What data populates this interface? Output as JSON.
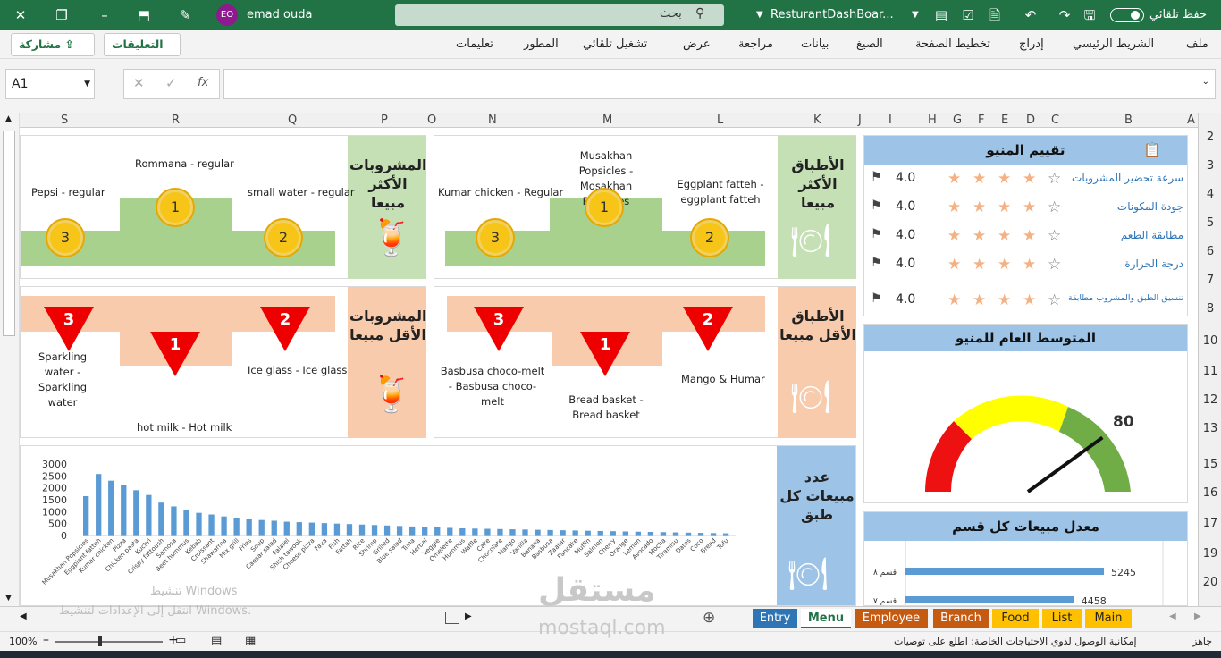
{
  "titlebar": {
    "autosave_label": "حفظ تلقائي",
    "filename": "ResturantDashBoar...",
    "search_placeholder": "بحث",
    "user_name": "emad ouda",
    "user_initials": "EO"
  },
  "ribbon": {
    "menu": [
      "ملف",
      "الشريط الرئيسي",
      "إدراج",
      "تخطيط الصفحة",
      "الصيغ",
      "بيانات",
      "مراجعة",
      "عرض",
      "تشغيل تلقائي",
      "المطور",
      "تعليمات"
    ],
    "comments_label": "التعليقات",
    "share_label": "مشاركة"
  },
  "formula_bar": {
    "name_box": "A1",
    "fx": "fx",
    "cancel": "✕",
    "enter": "✓"
  },
  "columns": [
    "S",
    "R",
    "Q",
    "P",
    "O",
    "N",
    "M",
    "L",
    "K",
    "J",
    "I",
    "H",
    "G",
    "F",
    "E",
    "D",
    "C",
    "B",
    "A"
  ],
  "rows": [
    "2",
    "3",
    "4",
    "5",
    "6",
    "7",
    "8",
    "10",
    "11",
    "12",
    "13",
    "15",
    "16",
    "17",
    "19",
    "20"
  ],
  "top_drinks": {
    "title": "المشروبات الأكثر مبيعا",
    "first": "Rommana - regular",
    "second": "small water - regular",
    "third": "Pepsi - regular",
    "ranks": [
      "1",
      "2",
      "3"
    ]
  },
  "top_dishes": {
    "title": "الأطباق الأكثر مبيعا",
    "first": "Musakhan Popsicles - Mosakhan Popsicles",
    "second": "Eggplant fatteh - eggplant fatteh",
    "third": "Kumar chicken - Regular",
    "ranks": [
      "1",
      "2",
      "3"
    ]
  },
  "low_drinks": {
    "title": "المشروبات الأقل مبيعا",
    "first": "hot milk - Hot milk",
    "second": "Ice glass - Ice glass",
    "third": "Sparkling water - Sparkling water",
    "ranks": [
      "1",
      "2",
      "3"
    ]
  },
  "low_dishes": {
    "title": "الأطباق الأقل مبيعا",
    "first": "Bread basket - Bread basket",
    "second": "Mango & Humar",
    "third": "Basbusa choco-melt - Basbusa choco-melt",
    "ranks": [
      "1",
      "2",
      "3"
    ]
  },
  "sales_count_title": "عدد مبيعات كل طبق",
  "rating": {
    "title": "تقييم المنيو",
    "items": [
      {
        "label": "سرعة تحضير المشروبات",
        "value": "4.0"
      },
      {
        "label": "جودة المكونات",
        "value": "4.0"
      },
      {
        "label": "مطابقة الطعم",
        "value": "4.0"
      },
      {
        "label": "درجة الحرارة",
        "value": "4.0"
      },
      {
        "label": "تنسيق الطبق والمشروب مطابقة",
        "value": "4.0"
      }
    ],
    "stars_filled": 4,
    "stars_total": 5
  },
  "gauge": {
    "title": "المتوسط العام للمنيو",
    "value": "80",
    "max": 100
  },
  "category_sales": {
    "title": "معدل مبيعات كل قسم",
    "rows": [
      {
        "label": "قسم ٨",
        "value": 5245
      },
      {
        "label": "قسم ٧",
        "value": 4458
      }
    ]
  },
  "chart_data": {
    "type": "bar",
    "ylim": [
      0,
      3000
    ],
    "yticks": [
      "3000",
      "2500",
      "2000",
      "1500",
      "1000",
      "500",
      "0"
    ],
    "categories": [
      "Musakhan Popsicles",
      "Eggplant fatteh",
      "Kumar chicken",
      "Pizza",
      "Chicken pasta",
      "Kuchri",
      "Crispy fattoush",
      "Samosa",
      "Beet hummus",
      "Kebab",
      "Croissant",
      "Shawarma",
      "Mix grill",
      "Fries",
      "Soup",
      "Caesar salad",
      "Falafel",
      "Shish tawook",
      "Cheese pizza",
      "Fava",
      "Fish",
      "Fattah",
      "Rice",
      "Shrimp",
      "Grilled",
      "Blue salad",
      "Tuna",
      "Herbal",
      "Veggie",
      "Omelette",
      "Hummus",
      "Waffle",
      "Cake",
      "Chocolate",
      "Mango",
      "Vanilla",
      "Banana",
      "Basbusa",
      "Zaatar",
      "Pancake",
      "Muffin",
      "Salmon",
      "Cherry",
      "Orange",
      "Lemon",
      "Avocado",
      "Mocha",
      "Tiramisu",
      "Dates",
      "Coco",
      "Bread",
      "Tofu"
    ],
    "values": [
      1650,
      2580,
      2300,
      2100,
      1900,
      1700,
      1380,
      1220,
      1050,
      950,
      880,
      800,
      750,
      700,
      650,
      620,
      580,
      560,
      540,
      520,
      500,
      480,
      460,
      440,
      420,
      400,
      380,
      360,
      340,
      320,
      300,
      290,
      280,
      270,
      260,
      250,
      240,
      230,
      220,
      210,
      200,
      190,
      180,
      170,
      160,
      150,
      140,
      130,
      120,
      110,
      100,
      90
    ]
  },
  "sheet_tabs": [
    {
      "label": "Entry",
      "color": "#2e75b6"
    },
    {
      "label": "Menu",
      "color": "#ffffff"
    },
    {
      "label": "Employee",
      "color": "#c55a11"
    },
    {
      "label": "Branch",
      "color": "#c55a11"
    },
    {
      "label": "Food",
      "color": "#ffc000"
    },
    {
      "label": "List",
      "color": "#ffc000"
    },
    {
      "label": "Main",
      "color": "#ffc000"
    }
  ],
  "status": {
    "ready": "جاهز",
    "accessibility": "إمكانية الوصول لذوي الاحتياجات الخاصة: اطلع على توصيات",
    "zoom": "100%"
  },
  "overlay": {
    "activate_line1": "تنشيط Windows",
    "activate_line2": "انتقل إلى الإعدادات لتنشيط Windows.",
    "watermark_ar": "مستقل",
    "watermark_en": "mostaql.com"
  },
  "colors": {
    "excel_green": "#217346",
    "green_panel": "#c5e0b4",
    "orange_panel": "#f8cbad",
    "blue_panel": "#9dc3e6",
    "bar_blue": "#5b9bd5",
    "star": "#f4b183"
  }
}
